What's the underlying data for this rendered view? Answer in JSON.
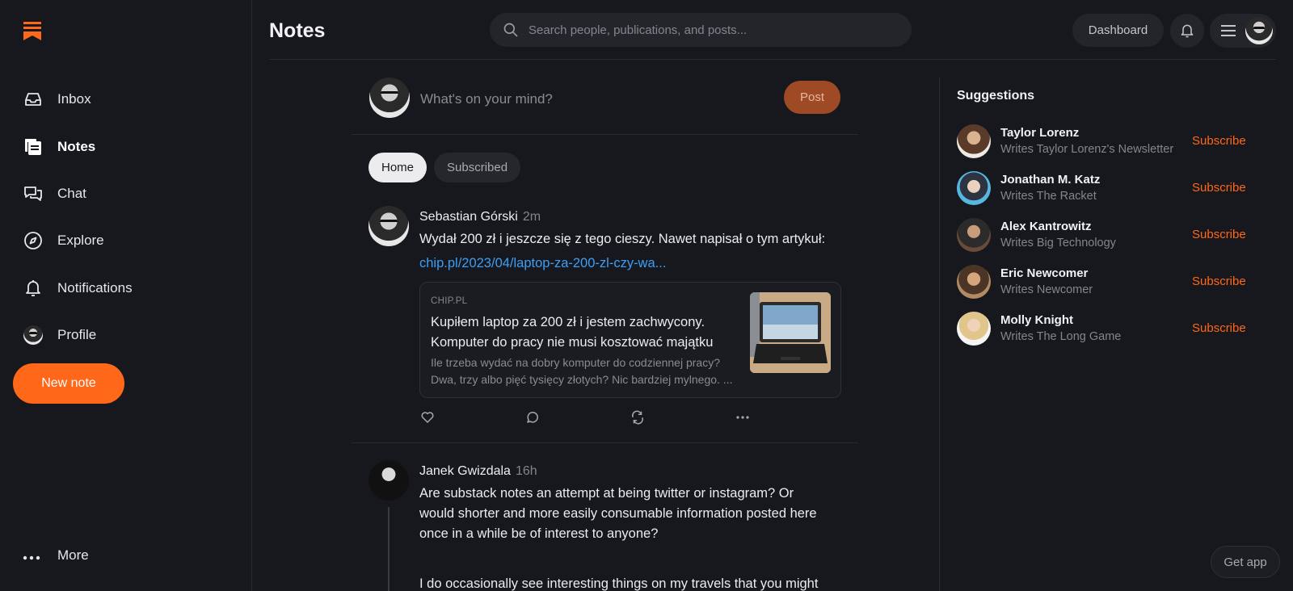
{
  "app": {
    "page_title": "Notes",
    "brand_color": "#ff6719"
  },
  "search": {
    "placeholder": "Search people, publications, and posts..."
  },
  "header": {
    "dashboard_label": "Dashboard"
  },
  "sidebar": {
    "items": [
      {
        "label": "Inbox",
        "icon": "inbox-icon"
      },
      {
        "label": "Notes",
        "icon": "notes-icon",
        "active": true
      },
      {
        "label": "Chat",
        "icon": "chat-icon"
      },
      {
        "label": "Explore",
        "icon": "compass-icon"
      },
      {
        "label": "Notifications",
        "icon": "bell-icon"
      },
      {
        "label": "Profile",
        "icon": "avatar"
      }
    ],
    "new_note_label": "New note",
    "more_label": "More"
  },
  "composer": {
    "placeholder": "What's on your mind?",
    "post_label": "Post"
  },
  "tabs": [
    {
      "label": "Home",
      "active": true
    },
    {
      "label": "Subscribed",
      "active": false
    }
  ],
  "posts": [
    {
      "author": "Sebastian Górski",
      "time": "2m",
      "text": "Wydał 200 zł i jeszcze się z tego cieszy. Nawet napisał o tym artykuł:",
      "link": "chip.pl/2023/04/laptop-za-200-zl-czy-wa...",
      "card": {
        "source": "CHIP.PL",
        "title": "Kupiłem laptop za 200 zł i jestem zachwycony. Komputer do pracy nie musi kosztować majątku",
        "description": "Ile trzeba wydać na dobry komputer do codziennej pracy? Dwa, trzy albo pięć tysięcy złotych? Nic bardziej mylnego. ..."
      }
    },
    {
      "author": "Janek Gwizdala",
      "time": "16h",
      "text": "Are substack notes an attempt at being twitter or instagram? Or would shorter and more easily consumable information posted here once in a while be of interest to anyone?",
      "text2": "I do occasionally see interesting things on my travels that you might dig."
    }
  ],
  "suggestions": {
    "title": "Suggestions",
    "subscribe_label": "Subscribe",
    "items": [
      {
        "name": "Taylor Lorenz",
        "sub": "Writes Taylor Lorenz's Newsletter"
      },
      {
        "name": "Jonathan M. Katz",
        "sub": "Writes The Racket"
      },
      {
        "name": "Alex Kantrowitz",
        "sub": "Writes Big Technology"
      },
      {
        "name": "Eric Newcomer",
        "sub": "Writes Newcomer"
      },
      {
        "name": "Molly Knight",
        "sub": "Writes The Long Game"
      }
    ]
  },
  "get_app_label": "Get app"
}
